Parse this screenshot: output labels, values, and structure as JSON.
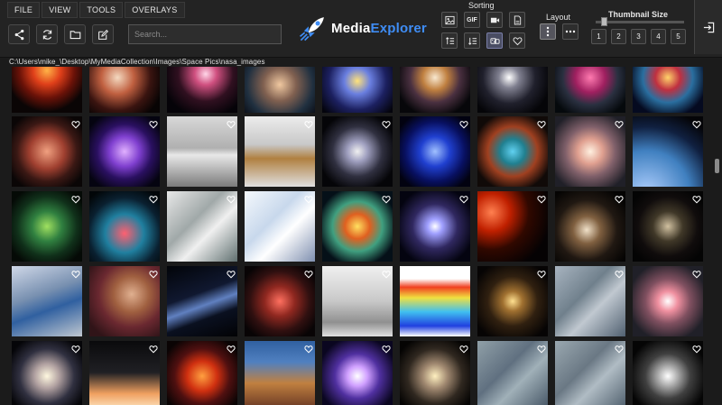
{
  "menu": {
    "items": [
      {
        "label": "FILE"
      },
      {
        "label": "VIEW"
      },
      {
        "label": "TOOLS"
      },
      {
        "label": "OVERLAYS"
      }
    ]
  },
  "toolbar": {
    "buttons": [
      {
        "icon": "share-icon"
      },
      {
        "icon": "refresh-icon"
      },
      {
        "icon": "folder-icon"
      },
      {
        "icon": "edit-icon"
      }
    ],
    "search_placeholder": "Search..."
  },
  "logo": {
    "prefix": "Media",
    "suffix": "Explorer"
  },
  "sorting": {
    "title": "Sorting",
    "row1": [
      {
        "icon": "image-icon",
        "label": ""
      },
      {
        "icon": "gif-icon",
        "label": "GIF"
      },
      {
        "icon": "video-icon",
        "label": ""
      },
      {
        "icon": "pdf-icon",
        "label": ""
      }
    ],
    "row2": [
      {
        "icon": "sort-asc-icon",
        "label": ""
      },
      {
        "icon": "sort-desc-icon",
        "label": ""
      },
      {
        "icon": "shuffle-icon",
        "label": ""
      },
      {
        "icon": "heart-icon",
        "label": ""
      }
    ]
  },
  "layout": {
    "title": "Layout",
    "active": "vertical"
  },
  "thumbnail_size": {
    "title": "Thumbnail Size",
    "options": [
      "1",
      "2",
      "3",
      "4",
      "5"
    ],
    "level": 0.08
  },
  "path": "C:\\Users\\mike_\\Desktop\\MyMediaCollection\\Images\\Space Pics\\nasa_images",
  "colors": {
    "accent": "#3f8df5",
    "background": "#1b1b1b",
    "toolbar": "#232323"
  },
  "grid": {
    "rows": [
      [
        "nebula-red",
        "nebula-orange",
        "galaxy-pink",
        "nebula-pillar",
        "galaxy-blue",
        "nebula-blast",
        "starfield-white",
        "nebula-pink",
        "nebula-cyan"
      ],
      [
        "nebula-veil",
        "nebula-crab-purple",
        "spacecraft-white",
        "satellite-gold",
        "galaxy-spiral-edge",
        "nebula-blue-glow",
        "bubble-nebula",
        "galaxy-spiral-pink",
        "earth-limb"
      ],
      [
        "nebula-green",
        "cells-microscopy",
        "earth-clouds",
        "earth-ice",
        "crab-nebula",
        "star-cluster",
        "planet-eclipse",
        "galaxy-dust",
        "starfield-dense"
      ],
      [
        "astronaut-hubble",
        "scientist-portrait",
        "earth-horizon",
        "nebula-red-dark",
        "cleanroom-rover",
        "temperature-map",
        "star-field-gold",
        "earth-coast",
        "galaxy-whirlpool"
      ],
      [
        "galaxy-m81",
        "rocket-launch",
        "nebula-hot",
        "carina-pillars",
        "galaxy-violet",
        "galaxy-andromeda",
        "earth-satellite",
        "earth-river",
        "galaxy-elliptical"
      ]
    ],
    "heart_visible": true
  }
}
